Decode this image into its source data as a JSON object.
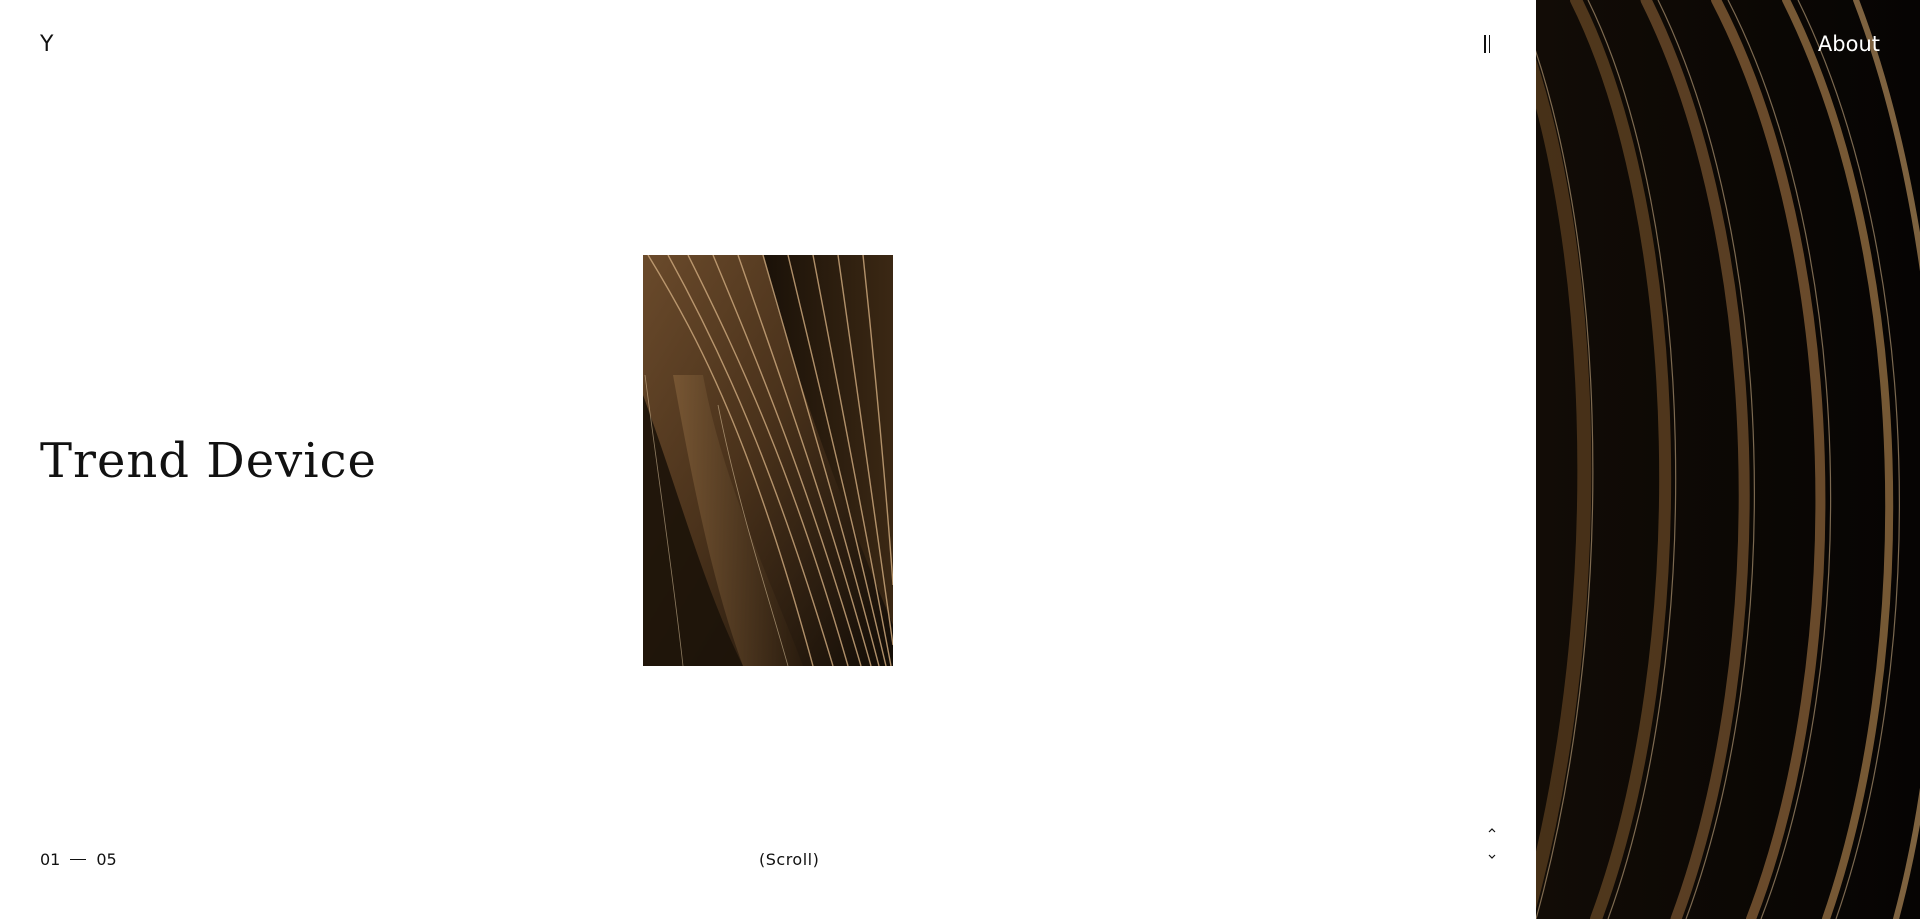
{
  "header": {
    "logo": "Y",
    "about_label": "About"
  },
  "hero": {
    "title": "Trend Device"
  },
  "footer": {
    "counter_current": "01",
    "counter_total": "05",
    "scroll_label": "(Scroll)"
  },
  "icons": {
    "menu": "menu-icon",
    "up": "chevron-up-icon",
    "down": "chevron-down-icon"
  },
  "colors": {
    "background": "#ffffff",
    "dark_panel": "#0b0906",
    "bronze": "#7a5530",
    "text": "#111111"
  }
}
